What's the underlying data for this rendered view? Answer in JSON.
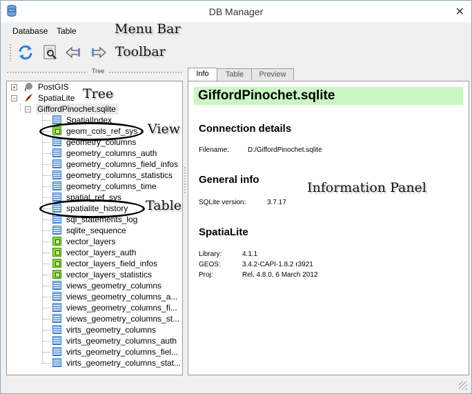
{
  "window": {
    "title": "DB Manager",
    "close_glyph": "✕"
  },
  "menu": [
    {
      "label": "Database"
    },
    {
      "label": "Table"
    }
  ],
  "toolbar": {
    "buttons": [
      {
        "name": "refresh",
        "icon": "refresh-icon"
      },
      {
        "name": "sql-window",
        "icon": "sql-window-icon"
      },
      {
        "name": "import-layer",
        "icon": "import-arrow-icon"
      },
      {
        "name": "export-layer",
        "icon": "export-arrow-icon"
      }
    ]
  },
  "tree_panel": {
    "title": "Tree"
  },
  "tree": {
    "providers": [
      {
        "label": "PostGIS",
        "expander": "+"
      },
      {
        "label": "SpatiaLite",
        "expander": "−"
      }
    ],
    "database": {
      "label": "GiffordPinochet.sqlite",
      "expander": "−"
    },
    "items": [
      {
        "label": "SpatialIndex",
        "kind": "table"
      },
      {
        "label": "geom_cols_ref_sys",
        "kind": "view"
      },
      {
        "label": "geometry_columns",
        "kind": "table"
      },
      {
        "label": "geometry_columns_auth",
        "kind": "table"
      },
      {
        "label": "geometry_columns_field_infos",
        "kind": "table"
      },
      {
        "label": "geometry_columns_statistics",
        "kind": "table"
      },
      {
        "label": "geometry_columns_time",
        "kind": "table"
      },
      {
        "label": "spatial_ref_sys",
        "kind": "table"
      },
      {
        "label": "spatialite_history",
        "kind": "table"
      },
      {
        "label": "sql_statements_log",
        "kind": "table"
      },
      {
        "label": "sqlite_sequence",
        "kind": "table"
      },
      {
        "label": "vector_layers",
        "kind": "view"
      },
      {
        "label": "vector_layers_auth",
        "kind": "view"
      },
      {
        "label": "vector_layers_field_infos",
        "kind": "view"
      },
      {
        "label": "vector_layers_statistics",
        "kind": "view"
      },
      {
        "label": "views_geometry_columns",
        "kind": "table"
      },
      {
        "label": "views_geometry_columns_a...",
        "kind": "table"
      },
      {
        "label": "views_geometry_columns_fi...",
        "kind": "table"
      },
      {
        "label": "views_geometry_columns_st...",
        "kind": "table"
      },
      {
        "label": "virts_geometry_columns",
        "kind": "table"
      },
      {
        "label": "virts_geometry_columns_auth",
        "kind": "table"
      },
      {
        "label": "virts_geometry_columns_fiel...",
        "kind": "table"
      },
      {
        "label": "virts_geometry_columns_stat...",
        "kind": "table"
      }
    ]
  },
  "tabs": [
    {
      "label": "Info",
      "active": true
    },
    {
      "label": "Table",
      "active": false
    },
    {
      "label": "Preview",
      "active": false
    }
  ],
  "info": {
    "title": "GiffordPinochet.sqlite",
    "connection": {
      "heading": "Connection details",
      "filename_label": "Filename:",
      "filename_value": "D:/GiffordPinochet.sqlite"
    },
    "general": {
      "heading": "General info",
      "sqlite_label": "SQLite version:",
      "sqlite_value": "3.7.17"
    },
    "spatialite": {
      "heading": "SpatiaLite",
      "library_label": "Library:",
      "library_value": "4.1.1",
      "geos_label": "GEOS:",
      "geos_value": "3.4.2-CAPI-1.8.2 r3921",
      "proj_label": "Proj:",
      "proj_value": "Rel. 4.8.0, 6 March 2012"
    }
  },
  "annotations": {
    "menu_bar": "Menu Bar",
    "toolbar": "Toolbar",
    "tree": "Tree",
    "view": "View",
    "table": "Table",
    "information_panel": "Information Panel"
  },
  "colors": {
    "title_highlight": "#c8f7c1",
    "table_icon": "#3d7cc7",
    "view_icon": "#8fd147",
    "panel_border": "#9a9a9a"
  }
}
